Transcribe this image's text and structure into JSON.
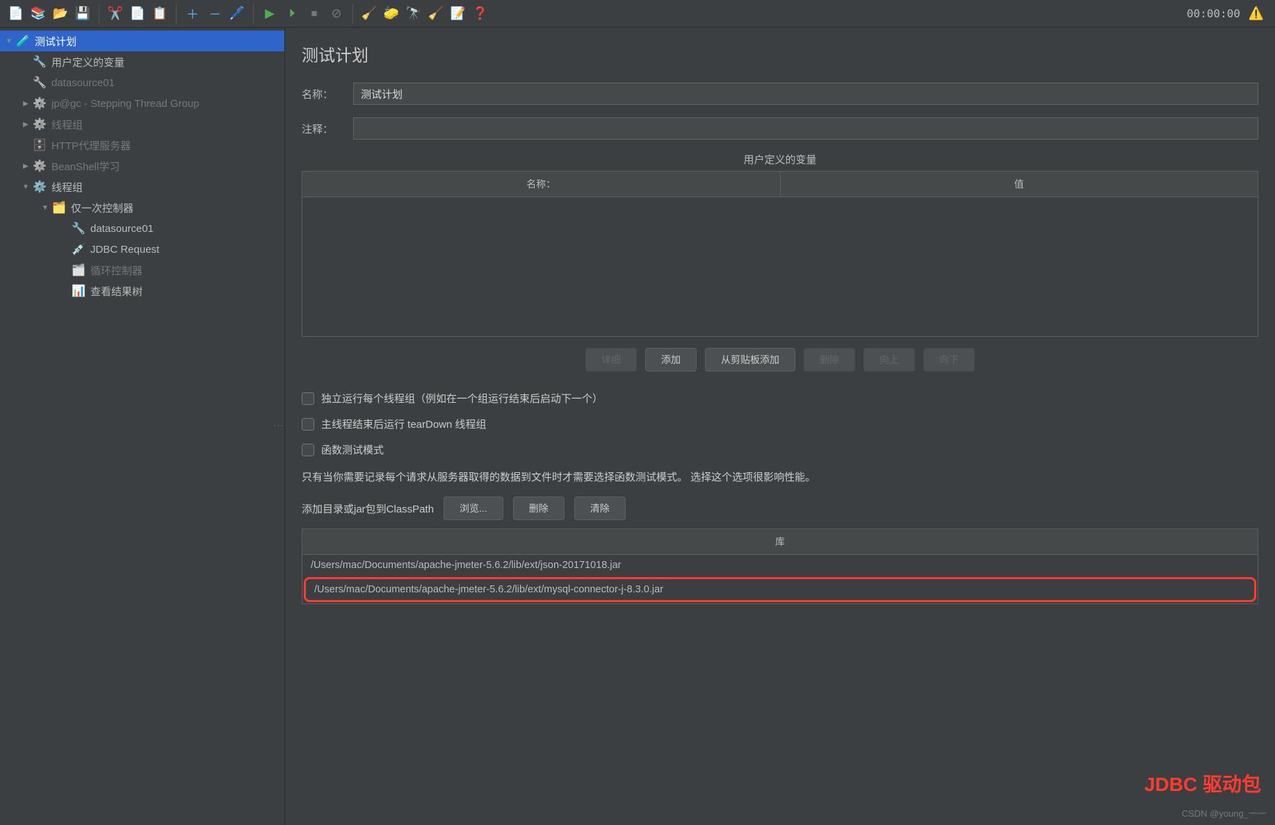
{
  "timer": "00:00:00",
  "tree": {
    "root": "测试计划",
    "items": [
      "用户定义的变量",
      "datasource01",
      "jp@gc - Stepping Thread Group",
      "线程组",
      "HTTP代理服务器",
      "BeanShell学习",
      "线程组",
      "仅一次控制器",
      "datasource01",
      "JDBC Request",
      "循环控制器",
      "查看结果树"
    ]
  },
  "panel": {
    "title": "测试计划",
    "name_label": "名称：",
    "name_value": "测试计划",
    "comment_label": "注释：",
    "comment_value": "",
    "vars_header": "用户定义的变量",
    "col_name": "名称：",
    "col_value": "值",
    "buttons": {
      "detail": "详细",
      "add": "添加",
      "paste": "从剪贴板添加",
      "delete": "删除",
      "up": "向上",
      "down": "向下"
    },
    "checks": {
      "independent": "独立运行每个线程组（例如在一个组运行结束后启动下一个）",
      "teardown": "主线程结束后运行 tearDown 线程组",
      "functest": "函数测试模式"
    },
    "hint": "只有当你需要记录每个请求从服务器取得的数据到文件时才需要选择函数测试模式。 选择这个选项很影响性能。",
    "classpath_label": "添加目录或jar包到ClassPath",
    "cp_buttons": {
      "browse": "浏览...",
      "delete": "删除",
      "clear": "清除"
    },
    "lib_header": "库",
    "libs": [
      "/Users/mac/Documents/apache-jmeter-5.6.2/lib/ext/json-20171018.jar",
      "/Users/mac/Documents/apache-jmeter-5.6.2/lib/ext/mysql-connector-j-8.3.0.jar"
    ]
  },
  "annotation": "JDBC 驱动包",
  "watermark": "CSDN @young_一一"
}
